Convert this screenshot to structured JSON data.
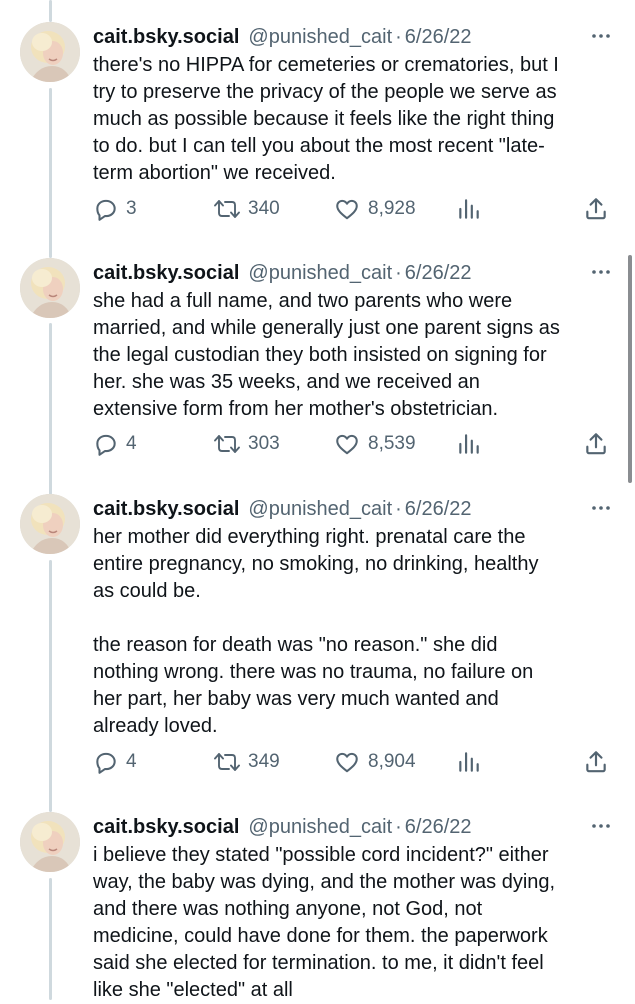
{
  "tweets": [
    {
      "display_name": "cait.bsky.social",
      "handle": "@punished_cait",
      "separator": "·",
      "date": "6/26/22",
      "text": "there's no HIPPA for cemeteries or crematories, but I\ntry to preserve the privacy of the people we serve as\nmuch as possible because it feels like the right thing\nto do. but I can tell you about the most recent \"late-\nterm abortion\" we received.",
      "replies": "3",
      "retweets": "340",
      "likes": "8,928"
    },
    {
      "display_name": "cait.bsky.social",
      "handle": "@punished_cait",
      "separator": "·",
      "date": "6/26/22",
      "text": "she had a full name, and two parents who were\nmarried, and while generally just one parent signs as\nthe legal custodian they both insisted on signing for\nher. she was 35 weeks, and we received an\nextensive form from her mother's obstetrician.",
      "replies": "4",
      "retweets": "303",
      "likes": "8,539"
    },
    {
      "display_name": "cait.bsky.social",
      "handle": "@punished_cait",
      "separator": "·",
      "date": "6/26/22",
      "text": "her mother did everything right. prenatal care the\nentire pregnancy, no smoking, no drinking, healthy\nas could be.\n\nthe reason for death was \"no reason.\" she did\nnothing wrong. there was no trauma, no failure on\nher part, her baby was very much wanted and\nalready loved.",
      "replies": "4",
      "retweets": "349",
      "likes": "8,904"
    },
    {
      "display_name": "cait.bsky.social",
      "handle": "@punished_cait",
      "separator": "·",
      "date": "6/26/22",
      "text": "i believe they stated \"possible cord incident?\" either\nway, the baby was dying, and the mother was dying,\nand there was nothing anyone, not God, not\nmedicine, could have done for them. the paperwork\nsaid she elected for termination. to me, it didn't feel\nlike she \"elected\" at all"
    }
  ],
  "icons": {
    "more": "more-icon",
    "reply": "reply-icon",
    "retweet": "retweet-icon",
    "like": "like-icon",
    "views": "views-icon",
    "share": "share-icon"
  },
  "colors": {
    "text": "#0f1419",
    "secondary": "#536471",
    "thread_line": "#cfd9de"
  }
}
